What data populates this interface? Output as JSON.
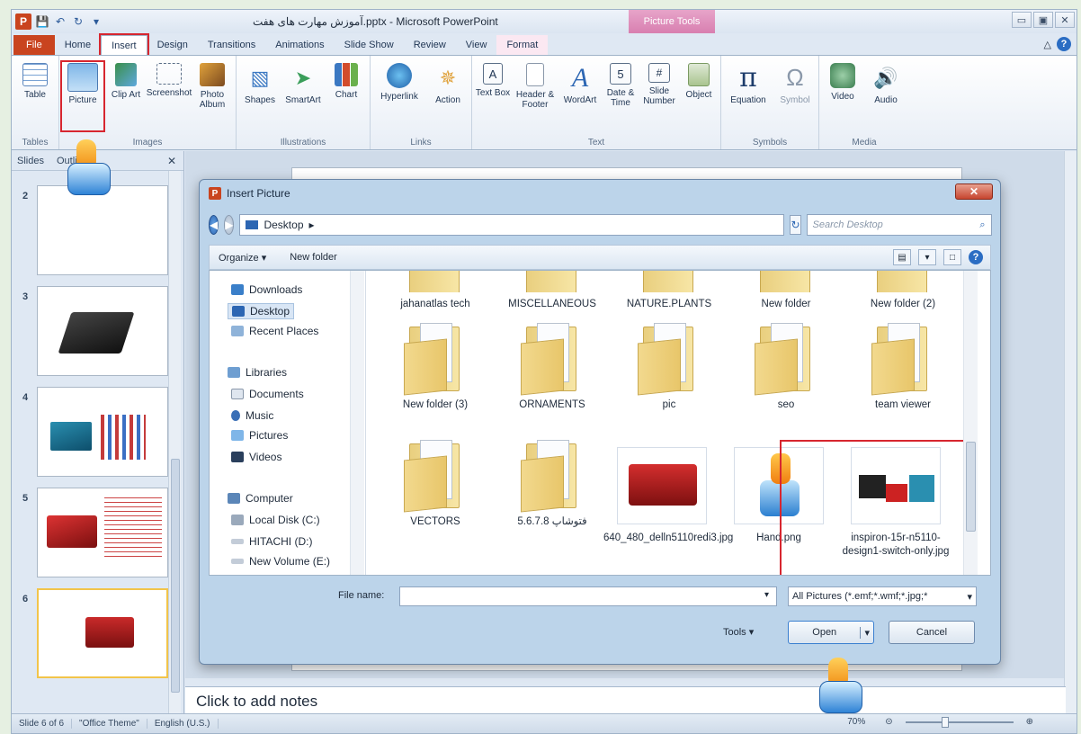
{
  "titlebar": {
    "title": "آموزش مهارت های هفت.pptx - Microsoft PowerPoint",
    "context_tab": "Picture Tools",
    "logo": "P",
    "window_buttons": [
      "▭",
      "▣",
      "✕"
    ]
  },
  "tabs": [
    "File",
    "Home",
    "Insert",
    "Design",
    "Transitions",
    "Animations",
    "Slide Show",
    "Review",
    "View",
    "Format"
  ],
  "ribbon": {
    "groups": [
      {
        "label": "Tables",
        "buttons": [
          {
            "label": "Table",
            "icon": "table-icon"
          }
        ]
      },
      {
        "label": "Images",
        "buttons": [
          {
            "label": "Picture",
            "icon": "picture-icon"
          },
          {
            "label": "Clip Art",
            "icon": "clip-art-icon"
          },
          {
            "label": "Screenshot",
            "icon": "screenshot-icon"
          },
          {
            "label": "Photo Album",
            "icon": "photo-album-icon"
          }
        ]
      },
      {
        "label": "Illustrations",
        "buttons": [
          {
            "label": "Shapes",
            "icon": "shapes-icon"
          },
          {
            "label": "SmartArt",
            "icon": "smartart-icon"
          },
          {
            "label": "Chart",
            "icon": "chart-icon"
          }
        ]
      },
      {
        "label": "Links",
        "buttons": [
          {
            "label": "Hyperlink",
            "icon": "hyperlink-icon"
          },
          {
            "label": "Action",
            "icon": "action-icon"
          }
        ]
      },
      {
        "label": "Text",
        "buttons": [
          {
            "label": "Text Box",
            "icon": "text-box-icon"
          },
          {
            "label": "Header & Footer",
            "icon": "header-footer-icon"
          },
          {
            "label": "WordArt",
            "icon": "wordart-icon"
          },
          {
            "label": "Date & Time",
            "icon": "date-time-icon"
          },
          {
            "label": "Slide Number",
            "icon": "slide-number-icon"
          },
          {
            "label": "Object",
            "icon": "object-icon"
          }
        ]
      },
      {
        "label": "Symbols",
        "buttons": [
          {
            "label": "Equation",
            "icon": "equation-icon"
          },
          {
            "label": "Symbol",
            "icon": "symbol-icon"
          }
        ]
      },
      {
        "label": "Media",
        "buttons": [
          {
            "label": "Video",
            "icon": "video-icon"
          },
          {
            "label": "Audio",
            "icon": "audio-icon"
          }
        ]
      }
    ]
  },
  "slides_panel": {
    "tab_slides": "Slides",
    "tab_outline": "Outline",
    "close": "✕",
    "slide_numbers": [
      "2",
      "3",
      "4",
      "5",
      "6"
    ]
  },
  "notes": {
    "placeholder": "Click to add notes"
  },
  "statusbar": {
    "slide": "Slide 6 of 6",
    "theme": "\"Office Theme\"",
    "language": "English (U.S.)",
    "zoom": "70%"
  },
  "dialog": {
    "title": "Insert Picture",
    "close": "✕",
    "address": "Desktop",
    "search_placeholder": "Search Desktop",
    "organize": "Organize ▾",
    "new_folder": "New folder",
    "nav_items": [
      "Downloads",
      "Desktop",
      "Recent Places",
      "Libraries",
      "Documents",
      "Music",
      "Pictures",
      "Videos",
      "Computer",
      "Local Disk (C:)",
      "HITACHI (D:)",
      "New Volume (E:)"
    ],
    "files": [
      {
        "name": "jahanatlas tech",
        "type": "folder"
      },
      {
        "name": "MISCELLANEOUS",
        "type": "folder"
      },
      {
        "name": "NATURE.PLANTS",
        "type": "folder"
      },
      {
        "name": "New folder",
        "type": "folder"
      },
      {
        "name": "New folder (2)",
        "type": "folder"
      },
      {
        "name": "New folder (3)",
        "type": "folder"
      },
      {
        "name": "ORNAMENTS",
        "type": "folder"
      },
      {
        "name": "pic",
        "type": "folder"
      },
      {
        "name": "seo",
        "type": "folder"
      },
      {
        "name": "team viewer",
        "type": "folder"
      },
      {
        "name": "VECTORS",
        "type": "folder"
      },
      {
        "name": "5.6.7.8 فتوشاپ",
        "type": "folder"
      },
      {
        "name": "640_480_delln5110redi3.jpg",
        "type": "image"
      },
      {
        "name": "Hand.png",
        "type": "image"
      },
      {
        "name": "inspiron-15r-n5110-design1-switch-only.jpg",
        "type": "image"
      }
    ],
    "file_name_label": "File name:",
    "file_name_value": "",
    "filter": "All Pictures (*.emf;*.wmf;*.jpg;*",
    "tools": "Tools",
    "open": "Open",
    "cancel": "Cancel"
  },
  "colors": {
    "accent_red": "#d7262f",
    "file_tab": "#c9441f",
    "picture_tools": "#d87fb0"
  }
}
